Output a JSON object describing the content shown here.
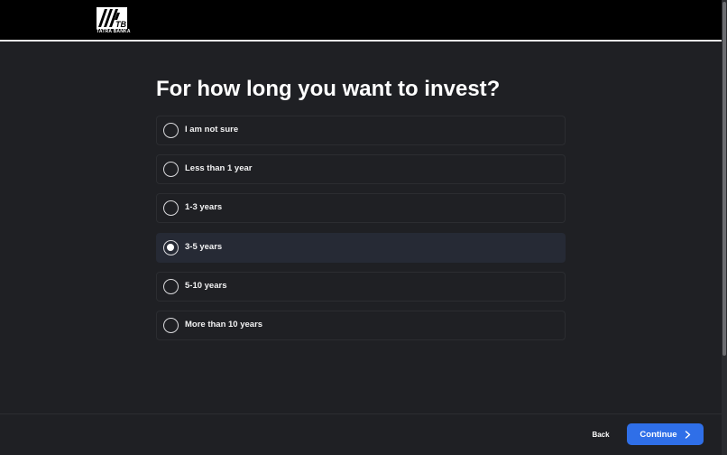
{
  "header": {
    "brand_name": "TATRA BANKA",
    "logo_monogram": "TB"
  },
  "page": {
    "title": "For how long you want to invest?"
  },
  "options": [
    {
      "label": "I am not sure",
      "selected": false
    },
    {
      "label": "Less than 1 year",
      "selected": false
    },
    {
      "label": "1-3 years",
      "selected": false
    },
    {
      "label": "3-5 years",
      "selected": true
    },
    {
      "label": "5-10 years",
      "selected": false
    },
    {
      "label": "More than 10 years",
      "selected": false
    }
  ],
  "footer": {
    "back_label": "Back",
    "continue_label": "Continue",
    "continue_icon": "chevron-right-icon"
  },
  "colors": {
    "background": "#1f2024",
    "header": "#000000",
    "accent": "#2f6fe8",
    "selected_row": "#262a35"
  }
}
